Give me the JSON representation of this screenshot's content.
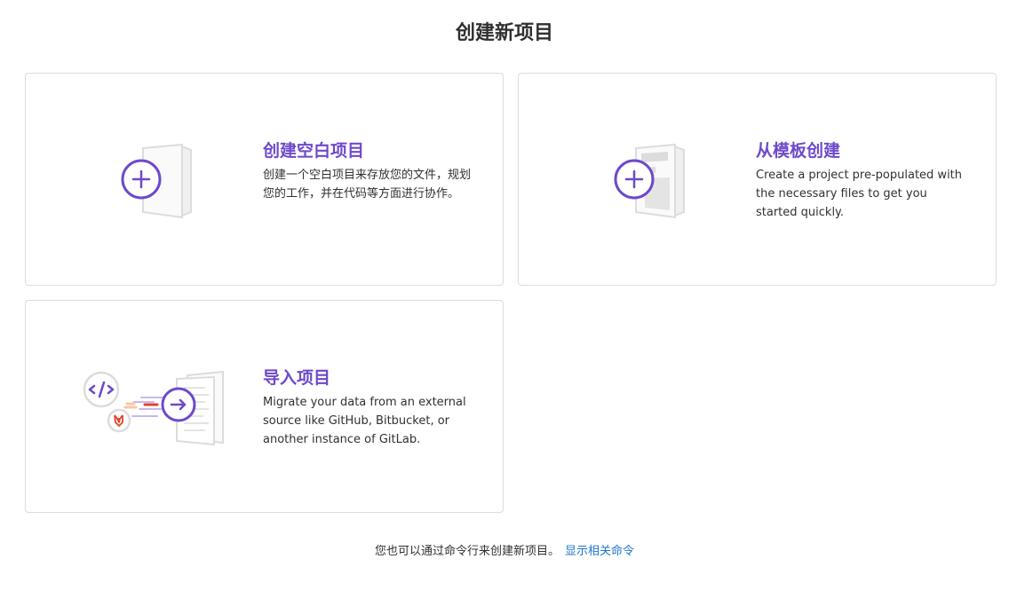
{
  "page": {
    "title": "创建新项目"
  },
  "cards": [
    {
      "title": "创建空白项目",
      "description": "创建一个空白项目来存放您的文件，规划您的工作，并在代码等方面进行协作。"
    },
    {
      "title": "从模板创建",
      "description": "Create a project pre-populated with the necessary files to get you started quickly."
    },
    {
      "title": "导入项目",
      "description": "Migrate your data from an external source like GitHub, Bitbucket, or another instance of GitLab."
    }
  ],
  "footer": {
    "text": "您也可以通过命令行来创建新项目。",
    "link_label": "显示相关命令"
  },
  "colors": {
    "accent": "#6e49cb",
    "link": "#1f75cb",
    "orange": "#e24329",
    "border": "#dcdcde"
  },
  "icons": [
    "plus-circle-icon",
    "document-icon",
    "code-icon",
    "gitlab-icon",
    "arrow-right-icon"
  ]
}
